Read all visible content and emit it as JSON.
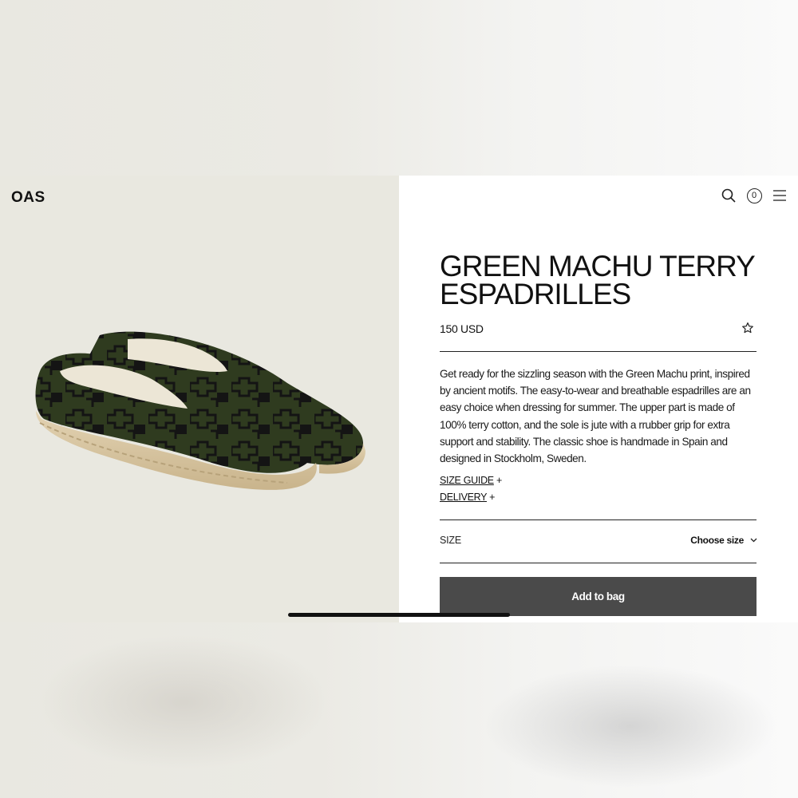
{
  "brand": {
    "logo_text": "OAS"
  },
  "header": {
    "cart_count": "0"
  },
  "product": {
    "title": "GREEN MACHU TERRY ESPADRILLES",
    "price": "150 USD",
    "description": "Get ready for the sizzling season with the Green Machu print, inspired by ancient motifs. The easy-to-wear and breathable espadrilles are an easy choice when dressing for summer. The upper part is made of 100% terry cotton, and the sole is jute with a rrubber grip for extra support and stability. The classic shoe is handmade in Spain and designed in Stockholm, Sweden."
  },
  "links": {
    "size_guide": "SIZE GUIDE",
    "delivery": "DELIVERY",
    "expand_symbol": "+"
  },
  "size": {
    "label": "SIZE",
    "selected": "Choose size"
  },
  "actions": {
    "add_to_bag": "Add to bag"
  },
  "icons": {
    "search": "search-icon",
    "cart": "cart-count-icon",
    "menu": "hamburger-menu-icon",
    "wishlist": "star-outline-icon",
    "dropdown": "chevron-down-icon"
  },
  "colors": {
    "shoe_green": "#2f3b1f",
    "pattern_black": "#141414",
    "jute": "#d6c3a0",
    "button_bg": "#4a4a4a"
  }
}
